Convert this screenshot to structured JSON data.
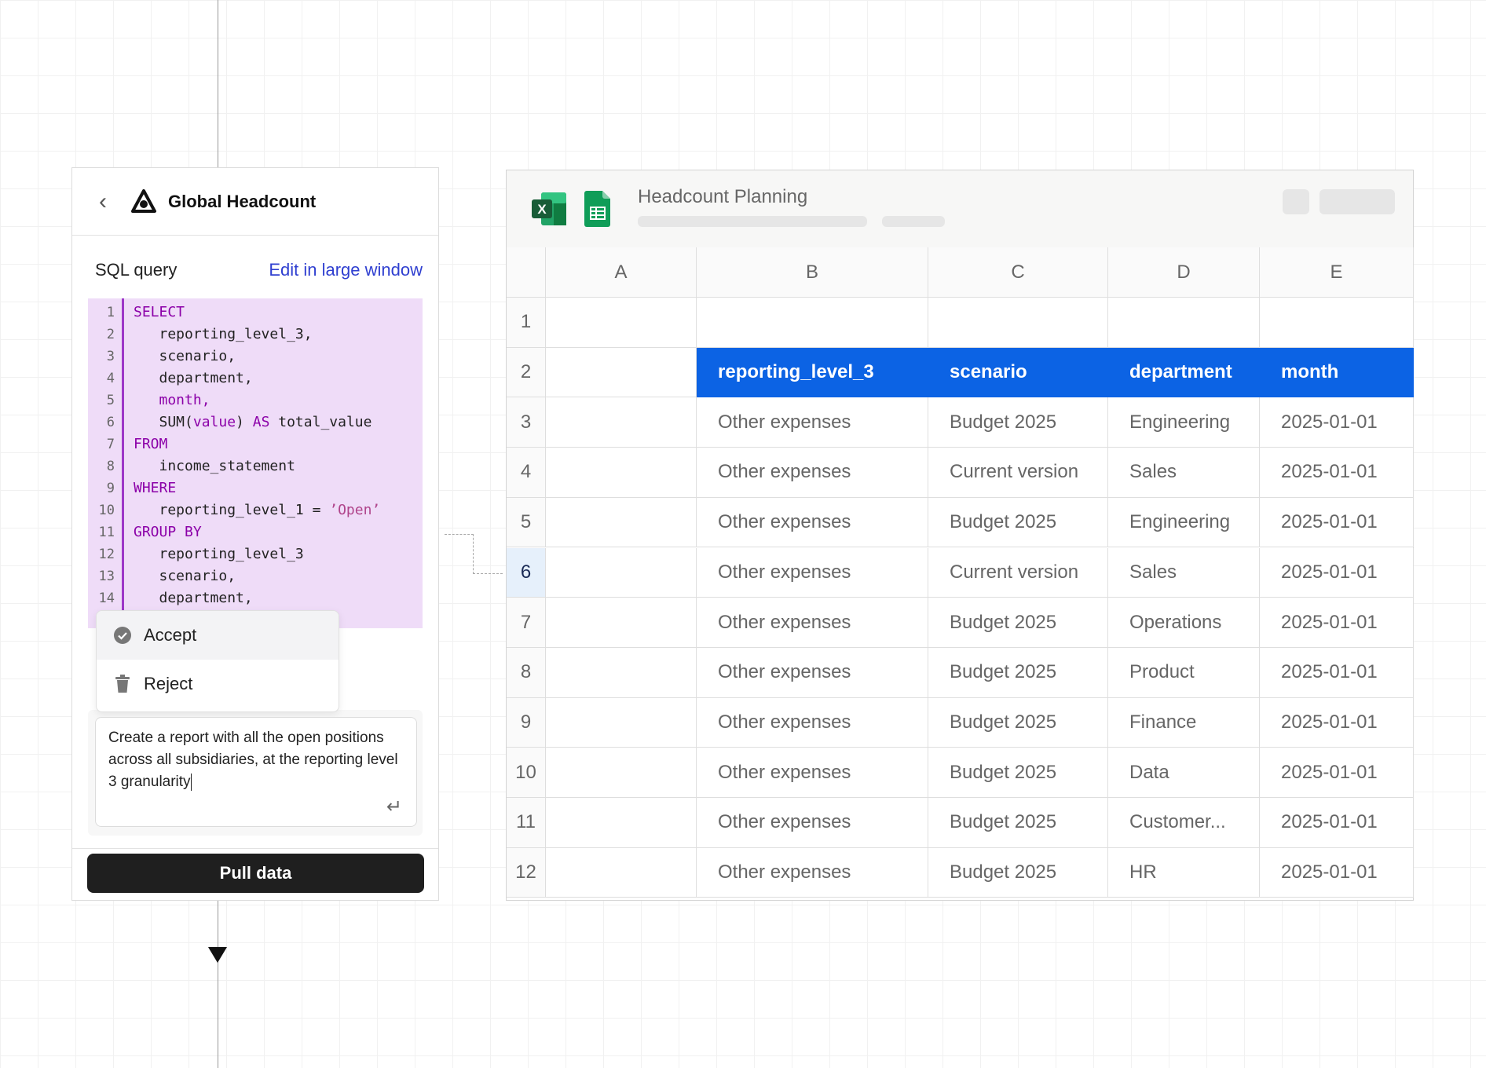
{
  "panel": {
    "title": "Global Headcount",
    "sql_label": "SQL query",
    "edit_link": "Edit in large window",
    "code_lines": [
      {
        "n": "1",
        "parts": [
          [
            "kw",
            "SELECT"
          ]
        ]
      },
      {
        "n": "2",
        "parts": [
          [
            "",
            "   reporting_level_3,"
          ]
        ]
      },
      {
        "n": "3",
        "parts": [
          [
            "",
            "   scenario,"
          ]
        ]
      },
      {
        "n": "4",
        "parts": [
          [
            "",
            "   department,"
          ]
        ]
      },
      {
        "n": "5",
        "parts": [
          [
            "kw",
            "   month,"
          ]
        ]
      },
      {
        "n": "6",
        "parts": [
          [
            "",
            "   SUM("
          ],
          [
            "kw",
            "value"
          ],
          [
            "",
            ") "
          ],
          [
            "kw",
            "AS"
          ],
          [
            "",
            " total_value"
          ]
        ]
      },
      {
        "n": "7",
        "parts": [
          [
            "kw",
            "FROM"
          ]
        ]
      },
      {
        "n": "8",
        "parts": [
          [
            "",
            "   income_statement"
          ]
        ]
      },
      {
        "n": "9",
        "parts": [
          [
            "kw",
            "WHERE"
          ]
        ]
      },
      {
        "n": "10",
        "parts": [
          [
            "",
            "   reporting_level_1 = "
          ],
          [
            "str",
            "’Open’"
          ]
        ]
      },
      {
        "n": "11",
        "parts": [
          [
            "kw",
            "GROUP BY"
          ]
        ]
      },
      {
        "n": "12",
        "parts": [
          [
            "",
            "   reporting_level_3"
          ]
        ]
      },
      {
        "n": "13",
        "parts": [
          [
            "",
            "   scenario,"
          ]
        ]
      },
      {
        "n": "14",
        "parts": [
          [
            "",
            "   department,"
          ]
        ]
      }
    ],
    "accept_label": "Accept",
    "reject_label": "Reject",
    "prompt_text": "Create a report with all the open positions across all subsidiaries, at the reporting level 3 granularity",
    "pull_button": "Pull data"
  },
  "sheet": {
    "title": "Headcount Planning",
    "columns": [
      "A",
      "B",
      "C",
      "D",
      "E"
    ],
    "header_row": [
      "reporting_level_3",
      "scenario",
      "department",
      "month"
    ],
    "rows": [
      [
        "Other expenses",
        "Budget 2025",
        "Engineering",
        "2025-01-01"
      ],
      [
        "Other expenses",
        "Current version",
        "Sales",
        "2025-01-01"
      ],
      [
        "Other expenses",
        "Budget 2025",
        "Engineering",
        "2025-01-01"
      ],
      [
        "Other expenses",
        "Current version",
        "Sales",
        "2025-01-01"
      ],
      [
        "Other expenses",
        "Budget 2025",
        "Operations",
        "2025-01-01"
      ],
      [
        "Other expenses",
        "Budget 2025",
        "Product",
        "2025-01-01"
      ],
      [
        "Other expenses",
        "Budget 2025",
        "Finance",
        "2025-01-01"
      ],
      [
        "Other expenses",
        "Budget 2025",
        "Data",
        "2025-01-01"
      ],
      [
        "Other expenses",
        "Budget 2025",
        "Customer...",
        "2025-01-01"
      ],
      [
        "Other expenses",
        "Budget 2025",
        "HR",
        "2025-01-01"
      ]
    ],
    "row_numbers": [
      "1",
      "2",
      "3",
      "4",
      "5",
      "6",
      "7",
      "8",
      "9",
      "10",
      "11",
      "12"
    ],
    "active_row": "6",
    "header_color": "#0c63e4"
  }
}
